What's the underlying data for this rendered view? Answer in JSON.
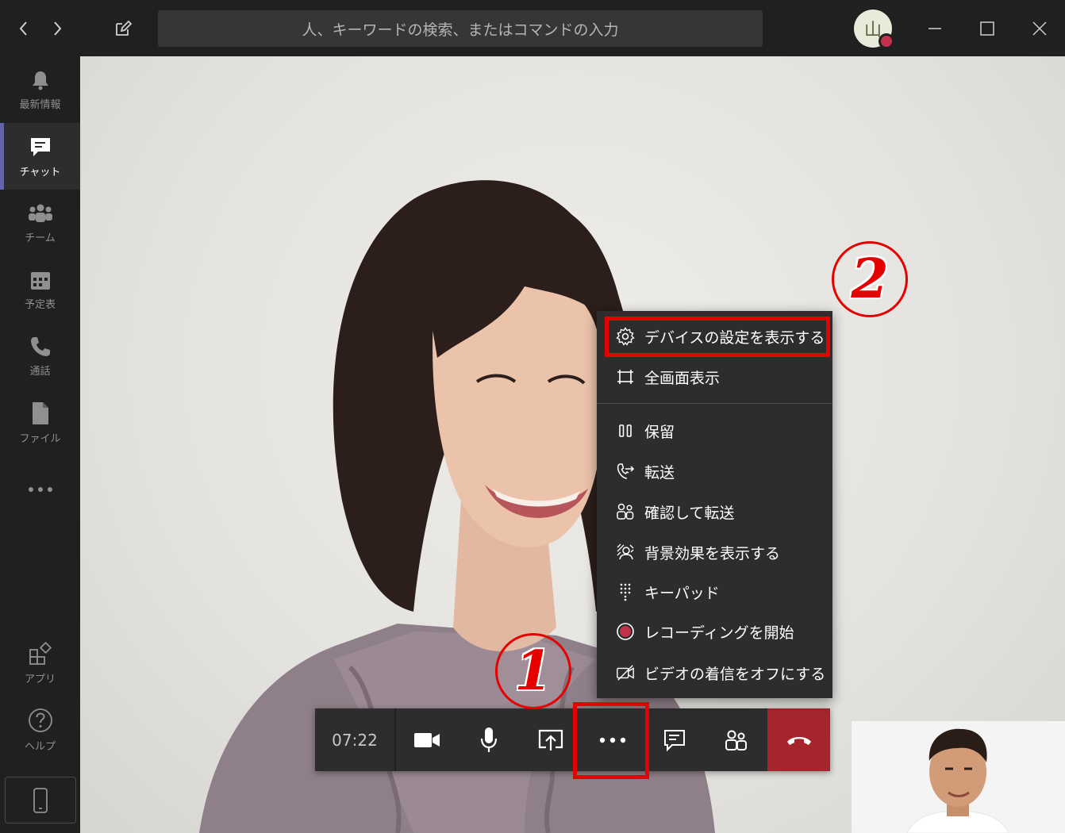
{
  "titlebar": {
    "search_placeholder": "人、キーワードの検索、またはコマンドの入力",
    "avatar_initial": "山"
  },
  "rail": {
    "items": [
      {
        "label": "最新情報"
      },
      {
        "label": "チャット"
      },
      {
        "label": "チーム"
      },
      {
        "label": "予定表"
      },
      {
        "label": "通話"
      },
      {
        "label": "ファイル"
      }
    ],
    "apps_label": "アプリ",
    "help_label": "ヘルプ"
  },
  "call": {
    "timer": "07:22",
    "hangup_color": "#a4262c"
  },
  "more_menu": {
    "items": [
      {
        "label": "デバイスの設定を表示する",
        "icon": "gear-icon"
      },
      {
        "label": "全画面表示",
        "icon": "fullscreen-icon"
      },
      {
        "label": "保留",
        "icon": "hold-icon"
      },
      {
        "label": "転送",
        "icon": "transfer-icon"
      },
      {
        "label": "確認して転送",
        "icon": "consult-transfer-icon"
      },
      {
        "label": "背景効果を表示する",
        "icon": "background-effects-icon"
      },
      {
        "label": "キーパッド",
        "icon": "keypad-icon"
      },
      {
        "label": "レコーディングを開始",
        "icon": "record-icon"
      },
      {
        "label": "ビデオの着信をオフにする",
        "icon": "video-off-icon"
      }
    ]
  },
  "annotations": {
    "step1": "1",
    "step2": "2",
    "color": "#e60000"
  }
}
